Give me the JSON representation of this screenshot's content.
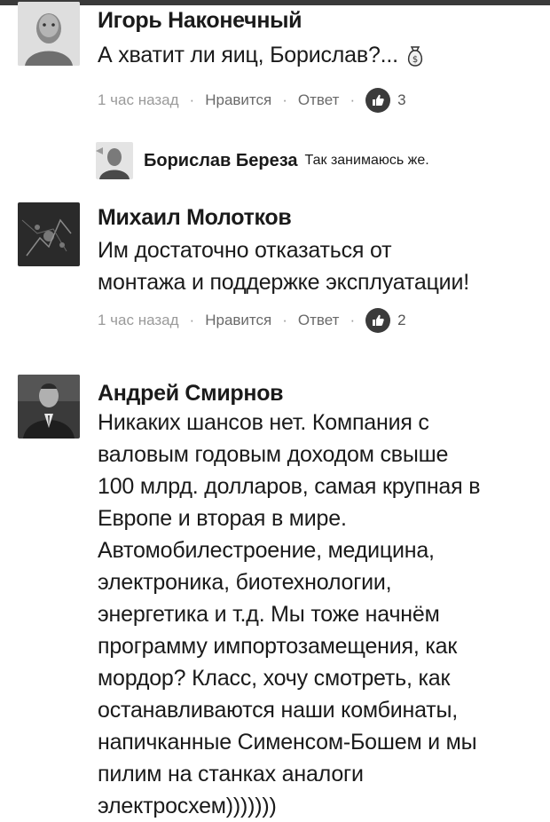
{
  "comments": [
    {
      "author": "Игорь Наконечный",
      "text": "А хватит ли яиц, Борислав?...",
      "emoji": "money-bag-icon",
      "time": "1 час назад",
      "like_label": "Нравится",
      "reply_label": "Ответ",
      "separator": "·",
      "likes": "3"
    },
    {
      "author": "Михаил Молотков",
      "text_lines": [
        "Им достаточно отказаться от",
        "монтажа и поддержке эксплуатации!"
      ],
      "time": "1 час назад",
      "like_label": "Нравится",
      "reply_label": "Ответ",
      "separator": "·",
      "likes": "2"
    },
    {
      "author": "Андрей Смирнов",
      "text_lines": [
        "Никаких шансов нет. Компания с",
        "валовым годовым доходом свыше",
        "100 млрд. долларов, самая крупная в",
        "Европе и вторая в мире.",
        "Автомобилестроение, медицина,",
        "электроника, биотехнологии,",
        "энергетика и т.д. Мы тоже начнём",
        "программу импортозамещения, как",
        "мордор? Класс, хочу смотреть, как",
        "останавливаются наши комбинаты,",
        "напичканные Сименсом-Бошем и мы",
        "пилим на станках аналоги",
        "электросхем)))))))"
      ]
    }
  ],
  "reply": {
    "author": "Борислав Береза",
    "text": "Так занимаюсь же."
  }
}
